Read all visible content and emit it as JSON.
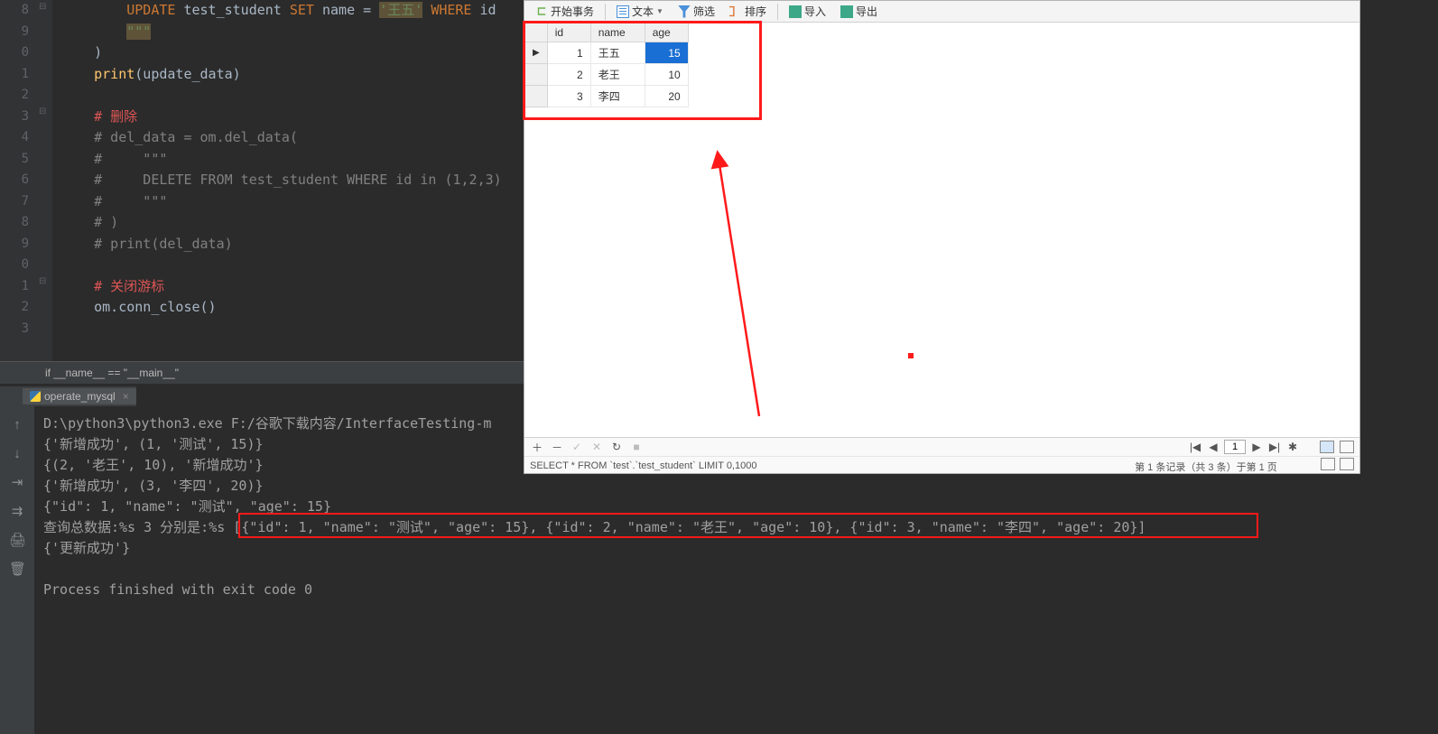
{
  "editor": {
    "lines": [
      "8",
      "9",
      "0",
      "1",
      "2",
      "3",
      "4",
      "5",
      "6",
      "7",
      "8",
      "9",
      "0",
      "1",
      "2",
      "3"
    ],
    "code_html": "        <span class='hl-kw'>UPDATE</span> <span class='hl-id'>test_student</span> <span class='hl-kw'>SET</span> <span class='hl-id'>name</span> = <span class='hl-str-bg'>'王五'</span> <span class='hl-kw'>WHERE</span> <span class='hl-id'>id</span>\n        <span class='hl-str-bg'>\"\"\"</span>\n    )\n    <span class='hl-fn'>print</span>(update_data)\n\n    <span class='hl-cmt-zh'># 删除</span>\n    <span class='hl-cmt'># del_data = om.del_data(</span>\n    <span class='hl-cmt'>#     \"\"\"</span>\n    <span class='hl-cmt'>#     DELETE FROM test_student WHERE id in (1,2,3)</span>\n    <span class='hl-cmt'>#     \"\"\"</span>\n    <span class='hl-cmt'># )</span>\n    <span class='hl-cmt'># print(del_data)</span>\n\n    <span class='hl-cmt-zh'># 关闭游标</span>\n    om.conn_close()\n",
    "breadcrumb": "if __name__ == \"__main__\""
  },
  "run": {
    "tab": "operate_mysql",
    "icons": [
      "↑",
      "↓",
      "⇥",
      "⇉",
      "🖨",
      "🗑"
    ],
    "out1": "D:\\python3\\python3.exe F:/谷歌下载内容/InterfaceTesting-m",
    "out2": "{'新增成功', (1, '测试', 15)}",
    "out3": "{(2, '老王', 10), '新增成功'}",
    "out4": "{'新增成功', (3, '李四', 20)}",
    "out5": "{\"id\": 1, \"name\": \"测试\", \"age\": 15}",
    "out6a": "查询总数据:%s 3 分别是:%s",
    "out6b": " [{\"id\": 1, \"name\": \"测试\", \"age\": 15}, {\"id\": 2, \"name\": \"老王\", \"age\": 10}, {\"id\": 3, \"name\": \"李四\", \"age\": 20}]",
    "out7": "{'更新成功'}",
    "out8": "",
    "out9": "Process finished with exit code 0"
  },
  "navicat": {
    "toolbar": {
      "begin": "开始事务",
      "text": "文本",
      "filter": "筛选",
      "sort": "排序",
      "import": "导入",
      "export": "导出"
    },
    "cols": {
      "id": "id",
      "name": "name",
      "age": "age"
    },
    "rows": [
      {
        "id": "1",
        "name": "王五",
        "age": "15",
        "sel": true,
        "ptr": true
      },
      {
        "id": "2",
        "name": "老王",
        "age": "10"
      },
      {
        "id": "3",
        "name": "李四",
        "age": "20"
      }
    ],
    "bottom": {
      "ctrl": {
        "plus": "＋",
        "minus": "－",
        "check": "✓",
        "x": "✕",
        "refresh": "↻",
        "stop": "■"
      },
      "nav": {
        "first": "|◀",
        "prev": "◀",
        "page": "1",
        "next": "▶",
        "last": "▶|",
        "gear": "✱"
      },
      "sql": "SELECT * FROM `test`.`test_student` LIMIT 0,1000",
      "status": "第 1 条记录（共 3 条）于第 1 页"
    }
  }
}
